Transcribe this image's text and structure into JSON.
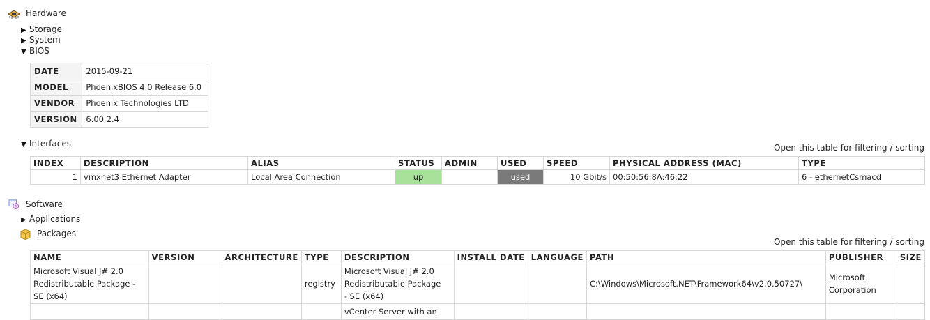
{
  "hardware": {
    "title": "Hardware",
    "icon": "hardware-chip-icon",
    "storage_label": "Storage",
    "system_label": "System",
    "bios_label": "BIOS",
    "bios": {
      "date_key": "DATE",
      "date_val": "2015-09-21",
      "model_key": "MODEL",
      "model_val": "PhoenixBIOS 4.0 Release 6.0",
      "vendor_key": "VENDOR",
      "vendor_val": "Phoenix Technologies LTD",
      "version_key": "VERSION",
      "version_val": "6.00 2.4"
    },
    "interfaces_label": "Interfaces",
    "interfaces_filter": "Open this table for filtering / sorting",
    "interfaces": {
      "headers": [
        "INDEX",
        "DESCRIPTION",
        "ALIAS",
        "STATUS",
        "ADMIN",
        "USED",
        "SPEED",
        "PHYSICAL ADDRESS (MAC)",
        "TYPE"
      ],
      "row": {
        "index": "1",
        "description": "vmxnet3 Ethernet Adapter",
        "alias": "Local Area Connection",
        "status": "up",
        "admin": "",
        "used": "used",
        "speed": "10 Gbit/s",
        "mac": "00:50:56:8A:46:22",
        "type": "6 - ethernetCsmacd"
      },
      "status_color": "#a8e29a",
      "used_color": "#7a7a7a"
    }
  },
  "software": {
    "title": "Software",
    "icon": "software-disc-icon",
    "applications_label": "Applications",
    "packages_label": "Packages",
    "packages_icon": "package-box-icon",
    "packages_filter": "Open this table for filtering / sorting",
    "packages": {
      "headers": [
        "NAME",
        "VERSION",
        "ARCHITECTURE",
        "TYPE",
        "DESCRIPTION",
        "INSTALL DATE",
        "LANGUAGE",
        "PATH",
        "PUBLISHER",
        "SIZE"
      ],
      "row1": {
        "name_l1": "Microsoft Visual J# 2.0",
        "name_l2": "Redistributable Package -",
        "name_l3": "SE (x64)",
        "type": "registry",
        "desc_l1": "Microsoft Visual J# 2.0",
        "desc_l2": "Redistributable Package",
        "desc_l3": "- SE (x64)",
        "path": "C:\\Windows\\Microsoft.NET\\Framework64\\v2.0.50727\\",
        "publisher_l1": "Microsoft",
        "publisher_l2": "Corporation"
      },
      "row2": {
        "desc_l1": "vCenter Server with an"
      }
    }
  }
}
